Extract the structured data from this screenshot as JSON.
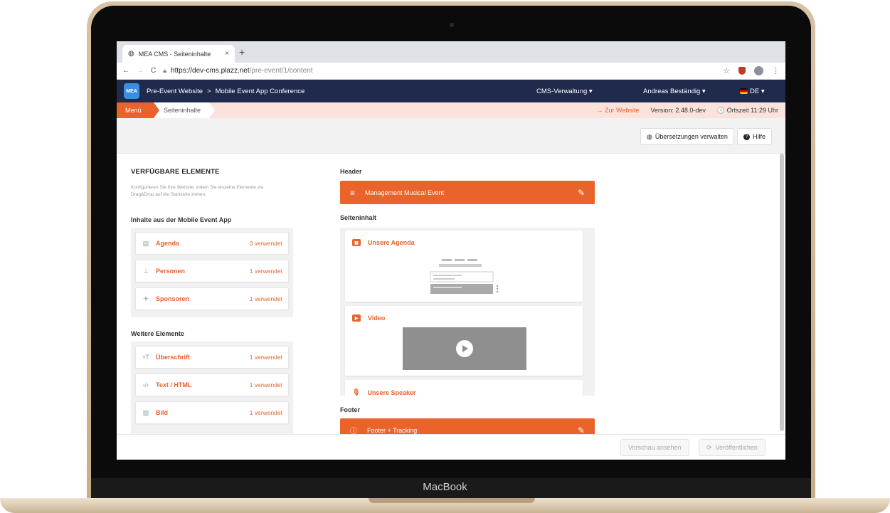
{
  "device": {
    "brand": "MacBook"
  },
  "browser": {
    "tab_title": "MEA CMS - Seiteninhalte",
    "tab_close": "×",
    "new_tab": "+",
    "url_host": "https://dev-cms.plazz.net",
    "url_path": "/pre-event/1/content",
    "back": "←",
    "forward": "→",
    "reload": "C",
    "star": "☆",
    "menu": "⋮"
  },
  "appnav": {
    "logo_text": "MEA",
    "crumb_1": "Pre-Event Website",
    "separator": ">",
    "crumb_2": "Mobile Event App Conference",
    "cms_menu": "CMS-Verwaltung ▾",
    "user_menu": "Andreas Beständig ▾",
    "language": "DE ▾"
  },
  "breadcrumb": {
    "menu": "Menü",
    "page": "Seiteninhalte",
    "to_website": "→  Zur Website",
    "version": "Version: 2.48.0-dev",
    "local_time": "🕓 Ortszeit 11:29 Uhr"
  },
  "toolbar": {
    "translations": "Übersetzungen verwalten",
    "help": "Hilfe"
  },
  "left_panel": {
    "title": "VERFÜGBARE ELEMENTE",
    "description": "Konfigurieren Sie Ihre Website, indem Sie einzelne Elemente via Drag&Drop auf die Startseite ziehen.",
    "app_section": "Inhalte aus der Mobile Event App",
    "app_items": [
      {
        "icon": "▤",
        "name": "Agenda",
        "used": "3 verwendet"
      },
      {
        "icon": "⊥",
        "name": "Personen",
        "used": "1 verwendet"
      },
      {
        "icon": "✈",
        "name": "Sponsoren",
        "used": "1 verwendet"
      }
    ],
    "more_section": "Weitere Elemente",
    "more_items": [
      {
        "icon": "тT",
        "name": "Überschrift",
        "used": "1 verwendet"
      },
      {
        "icon": "‹/›",
        "name": "Text / HTML",
        "used": "1 verwendet"
      },
      {
        "icon": "▧",
        "name": "Bild",
        "used": "1 verwendet"
      }
    ]
  },
  "editor": {
    "header_label": "Header",
    "header_bar": "Management Musical Event",
    "content_label": "Seiteninhalt",
    "cards": [
      {
        "title": "Unsere Agenda"
      },
      {
        "title": "Video"
      },
      {
        "title": "Unsere Speaker"
      }
    ],
    "footer_label": "Footer",
    "footer_bar": "Footer + Tracking"
  },
  "bottom": {
    "preview": "Vorschau ansehen",
    "publish": "Veröffentlichen"
  },
  "colors": {
    "accent": "#e9632a",
    "navbar": "#1f2a4d",
    "crumb_bg": "#fbe3dc"
  }
}
